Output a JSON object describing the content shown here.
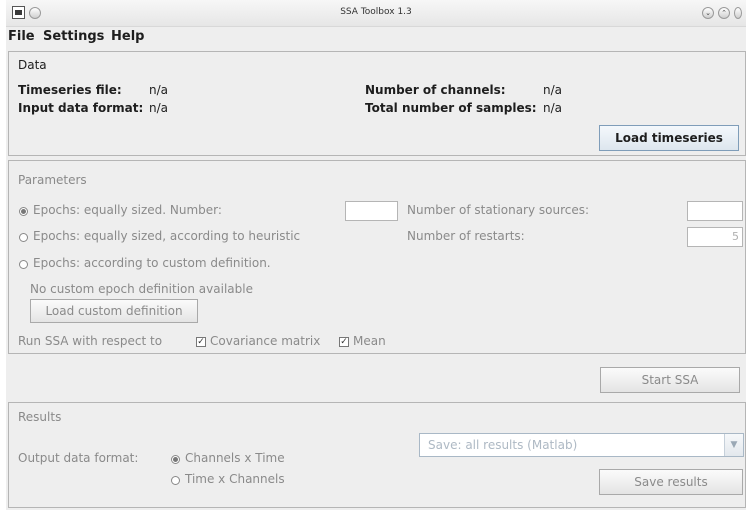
{
  "window": {
    "title": "SSA Toolbox 1.3",
    "minimize_glyph": "⌄",
    "maximize_glyph": "⌃"
  },
  "menu": [
    "File",
    "Settings",
    "Help"
  ],
  "data_section": {
    "title": "Data",
    "timeseries_file_label": "Timeseries file:",
    "timeseries_file_value": "n/a",
    "input_format_label": "Input data format:",
    "input_format_value": "n/a",
    "channels_label": "Number of channels:",
    "channels_value": "n/a",
    "samples_label": "Total number of samples:",
    "samples_value": "n/a",
    "load_button": "Load timeseries"
  },
  "parameters": {
    "title": "Parameters",
    "epoch_options": [
      {
        "label": "Epochs: equally sized. Number:",
        "selected": true
      },
      {
        "label": "Epochs: equally sized, according to heuristic",
        "selected": false
      },
      {
        "label": "Epochs: according to custom definition.",
        "selected": false
      }
    ],
    "epochs_number_value": "",
    "stationary_sources_label": "Number of stationary sources:",
    "stationary_sources_value": "",
    "restarts_label": "Number of restarts:",
    "restarts_value": "5",
    "no_custom_text": "No custom epoch definition available",
    "load_custom_button": "Load custom definition",
    "run_ssa_label": "Run SSA with respect to",
    "covariance_label": "Covariance matrix",
    "covariance_checked": true,
    "mean_label": "Mean",
    "mean_checked": true,
    "check_glyph": "✓"
  },
  "start_button": "Start SSA",
  "results": {
    "title": "Results",
    "output_format_label": "Output data format:",
    "format_options": [
      {
        "label": "Channels x Time",
        "selected": true
      },
      {
        "label": "Time x Channels",
        "selected": false
      }
    ],
    "save_combo_value": "Save: all results (Matlab)",
    "combo_arrow": "▼",
    "save_button": "Save results"
  }
}
